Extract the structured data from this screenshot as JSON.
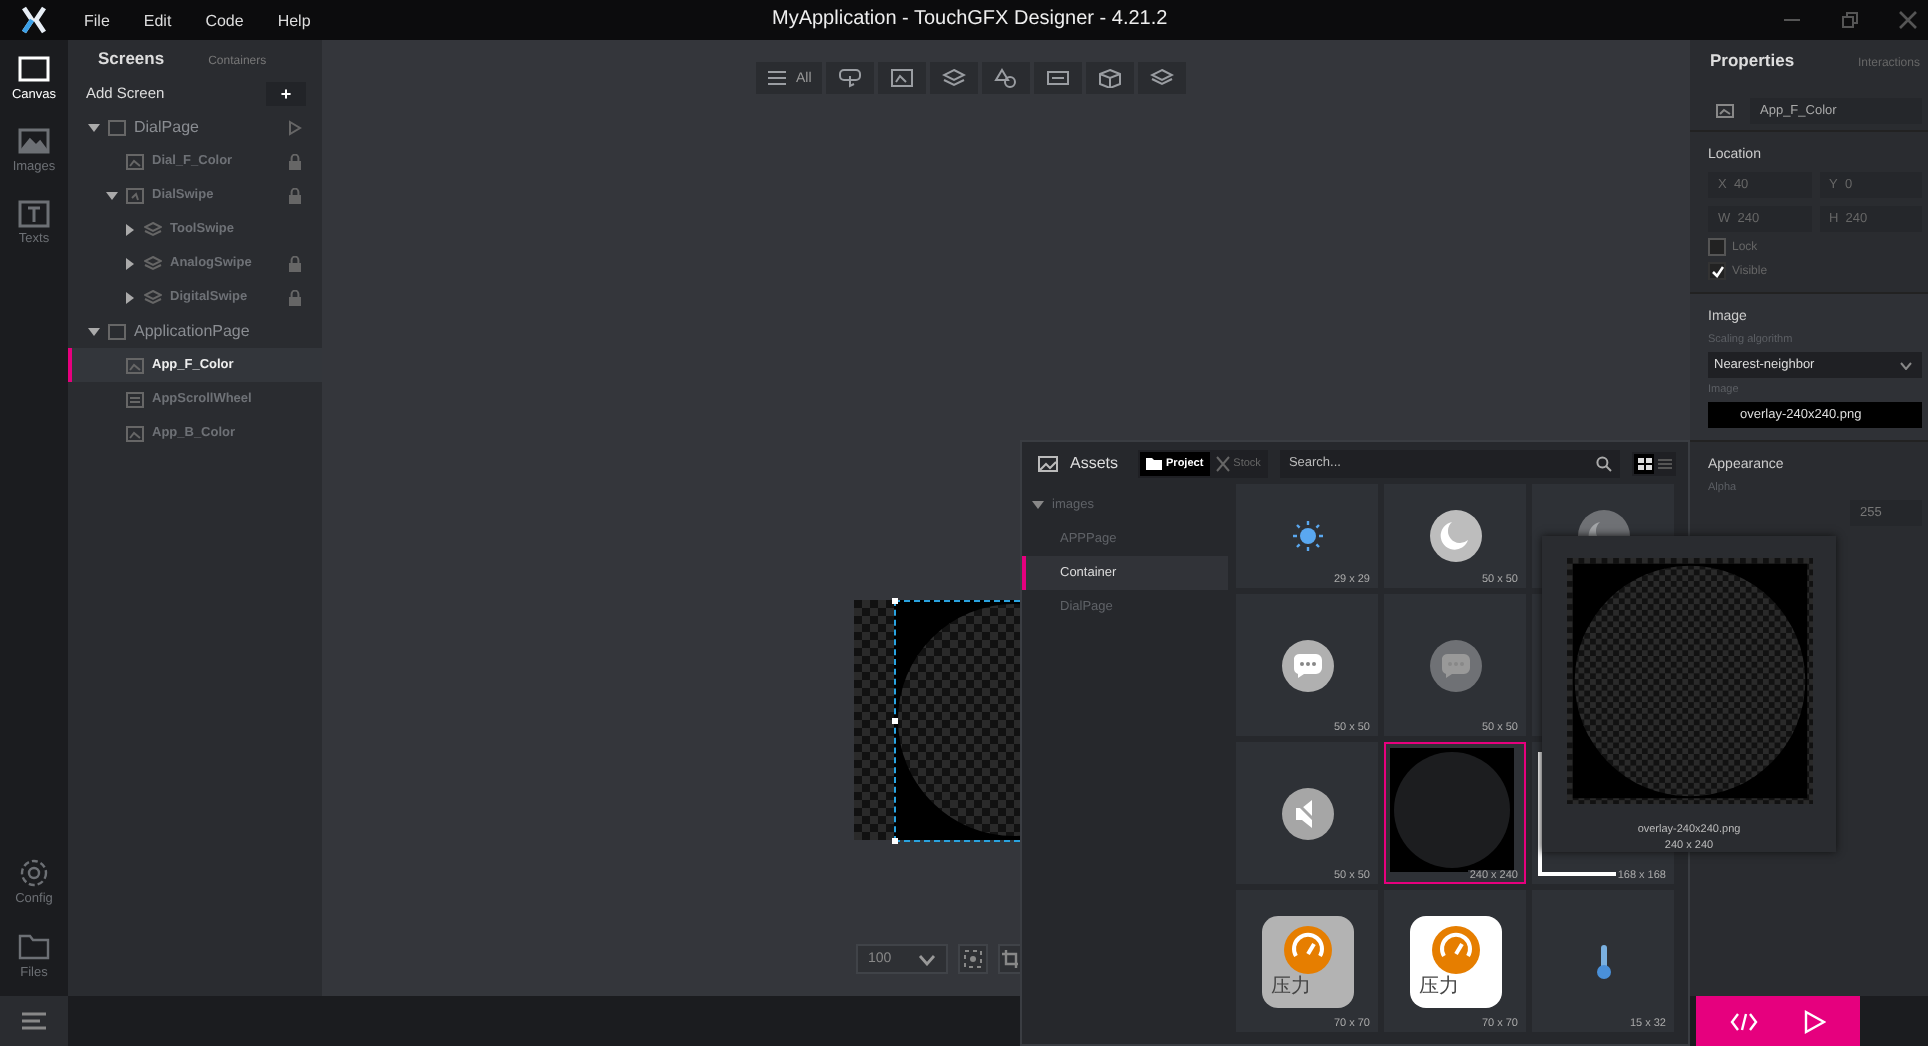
{
  "window": {
    "title": "MyApplication - TouchGFX Designer - 4.21.2"
  },
  "menu": [
    "File",
    "Edit",
    "Code",
    "Help"
  ],
  "rail": {
    "top": [
      {
        "label": "Canvas",
        "kind": "canvas",
        "selected": true
      },
      {
        "label": "Images",
        "kind": "images",
        "selected": false
      },
      {
        "label": "Texts",
        "kind": "texts",
        "selected": false
      }
    ],
    "bottom": [
      {
        "label": "Config",
        "kind": "config",
        "selected": false
      },
      {
        "label": "Files",
        "kind": "files",
        "selected": false
      }
    ]
  },
  "screens_panel": {
    "tabs": [
      {
        "label": "Screens",
        "selected": true
      },
      {
        "label": "Containers",
        "selected": false
      }
    ],
    "add_label": "Add Screen",
    "add_button": "+",
    "tree": [
      {
        "label": "DialPage",
        "kind": "screen",
        "initial": true,
        "selected": false,
        "expanded": true,
        "children": [
          {
            "label": "Dial_F_Color",
            "kind": "image",
            "locked": true,
            "selected": false
          },
          {
            "label": "DialSwipe",
            "kind": "swipe",
            "locked": true,
            "selected": false,
            "expanded": true,
            "children": [
              {
                "label": "ToolSwipe",
                "kind": "container",
                "locked": false,
                "selected": false,
                "expanded": false
              },
              {
                "label": "AnalogSwipe",
                "kind": "container",
                "locked": true,
                "selected": false,
                "expanded": false
              },
              {
                "label": "DigitalSwipe",
                "kind": "container",
                "locked": true,
                "selected": false,
                "expanded": false
              }
            ]
          }
        ]
      },
      {
        "label": "ApplicationPage",
        "kind": "screen",
        "initial": false,
        "selected": false,
        "expanded": true,
        "children": [
          {
            "label": "App_F_Color",
            "kind": "image",
            "locked": false,
            "selected": true
          },
          {
            "label": "AppScrollWheel",
            "kind": "scroll",
            "locked": false,
            "selected": false
          },
          {
            "label": "App_B_Color",
            "kind": "image",
            "locked": false,
            "selected": false
          }
        ]
      }
    ]
  },
  "toolbar": [
    {
      "kind": "all",
      "label": "All"
    },
    {
      "kind": "interaction"
    },
    {
      "kind": "image"
    },
    {
      "kind": "container"
    },
    {
      "kind": "shapes"
    },
    {
      "kind": "misc"
    },
    {
      "kind": "cube"
    },
    {
      "kind": "layers"
    }
  ],
  "canvas": {
    "zoom": "100"
  },
  "properties": {
    "tabs": [
      {
        "label": "Properties",
        "selected": true
      },
      {
        "label": "Interactions",
        "selected": false
      }
    ],
    "name": "App_F_Color",
    "location_title": "Location",
    "fields": [
      {
        "label": "X",
        "value": "40"
      },
      {
        "label": "Y",
        "value": "0"
      },
      {
        "label": "W",
        "value": "240"
      },
      {
        "label": "H",
        "value": "240"
      }
    ],
    "checks": [
      {
        "label": "Lock",
        "checked": false
      },
      {
        "label": "Visible",
        "checked": true
      }
    ],
    "image_title": "Image",
    "scaling_label": "Scaling algorithm",
    "scaling_value": "Nearest-neighbor",
    "image_label": "Image",
    "image_value": "overlay-240x240.png",
    "appearance_title": "Appearance",
    "alpha_label": "Alpha",
    "alpha_value": "255"
  },
  "assets": {
    "title": "Assets",
    "sources": [
      {
        "label": "Project",
        "selected": true
      },
      {
        "label": "Stock",
        "selected": false
      }
    ],
    "search": {
      "placeholder": "Search..."
    },
    "views": [
      {
        "kind": "grid",
        "selected": true
      },
      {
        "kind": "list",
        "selected": false
      }
    ],
    "folder": {
      "label": "images",
      "expanded": true,
      "children": [
        {
          "label": "APPPage",
          "selected": false
        },
        {
          "label": "Container",
          "selected": true
        },
        {
          "label": "DialPage",
          "selected": false
        }
      ]
    },
    "tiles": [
      {
        "kind": "sun",
        "size": "29 x 29",
        "selected": false
      },
      {
        "kind": "moon",
        "size": "50 x 50",
        "selected": false
      },
      {
        "kind": "moon-dim",
        "selected": false
      },
      {
        "kind": "chat",
        "size": "50 x 50",
        "selected": false
      },
      {
        "kind": "chat-dim",
        "size": "50 x 50",
        "selected": false
      },
      {
        "kind": "covered"
      },
      {
        "kind": "mute",
        "size": "50 x 50",
        "selected": false
      },
      {
        "kind": "ring",
        "size": "240 x 240",
        "selected": true
      },
      {
        "kind": "corner",
        "size": "168 x 168",
        "selected": false
      },
      {
        "kind": "gauge-grey",
        "caption": "压力",
        "size": "70 x 70",
        "selected": false
      },
      {
        "kind": "gauge-white",
        "caption": "压力",
        "size": "70 x 70",
        "selected": false
      },
      {
        "kind": "thermometer",
        "size": "15 x 32",
        "selected": false
      }
    ],
    "preview": {
      "file": "overlay-240x240.png",
      "size": "240 x 240"
    }
  }
}
